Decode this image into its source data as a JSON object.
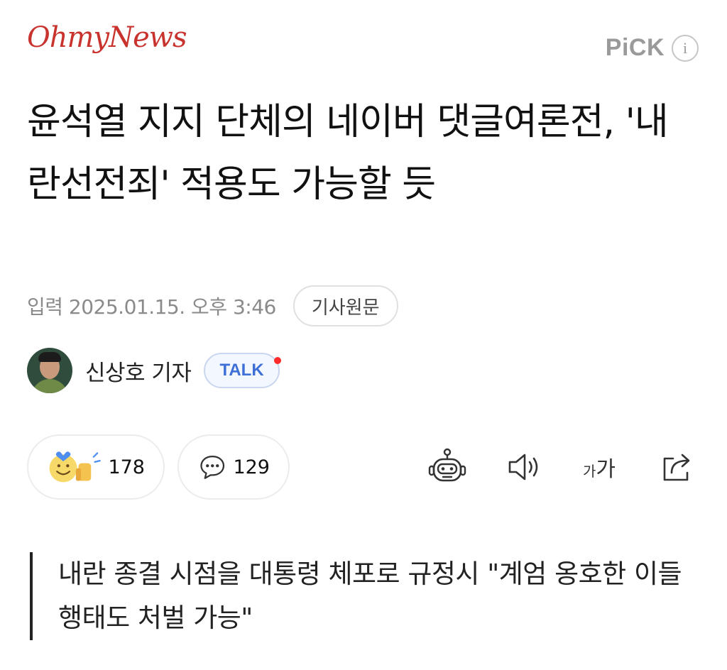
{
  "header": {
    "logo_text": "OhmyNews",
    "pick_label": "PiCK",
    "info_icon_text": "i"
  },
  "article": {
    "title": "윤석열 지지 단체의 네이버 댓글여론전, '내란선전죄' 적용도 가능할 듯",
    "date_text": "입력 2025.01.15. 오후 3:46",
    "origin_button_label": "기사원문",
    "author_name": "신상호 기자",
    "talk_label": "TALK",
    "subheading": "내란 종결 시점을 대통령 체포로 규정시 \"계엄 옹호한 이들 행태도 처벌 가능\""
  },
  "actions": {
    "reaction_count": "178",
    "comment_count": "129",
    "font_size_label_small": "가",
    "font_size_label_large": "가"
  },
  "colors": {
    "logo": "#c8332e",
    "talk_text": "#3d6fd6",
    "notification_dot": "#ff2b2b",
    "muted_text": "#8a8a8a"
  },
  "icons": [
    "info-icon",
    "reaction-emoji-icon",
    "speech-bubble-icon",
    "ai-robot-icon",
    "speaker-icon",
    "share-icon"
  ]
}
